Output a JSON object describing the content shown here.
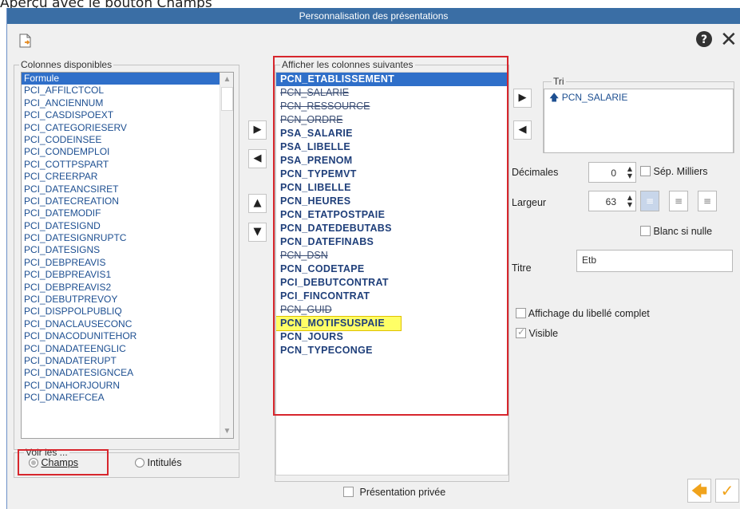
{
  "page_caption": "Aperçu avec le bouton Champs",
  "window": {
    "title": "Personnalisation des présentations"
  },
  "toolbar": {
    "doc_icon": "export-document-icon",
    "help_glyph": "?",
    "close_glyph": "✕"
  },
  "available": {
    "label": "Colonnes disponibles",
    "items": [
      "Formule",
      "PCI_AFFILCTCOL",
      "PCI_ANCIENNUM",
      "PCI_CASDISPOEXT",
      "PCI_CATEGORIESERV",
      "PCI_CODEINSEE",
      "PCI_CONDEMPLOI",
      "PCI_COTTPSPART",
      "PCI_CREERPAR",
      "PCI_DATEANCSIRET",
      "PCI_DATECREATION",
      "PCI_DATEMODIF",
      "PCI_DATESIGND",
      "PCI_DATESIGNRUPTC",
      "PCI_DATESIGNS",
      "PCI_DEBPREAVIS",
      "PCI_DEBPREAVIS1",
      "PCI_DEBPREAVIS2",
      "PCI_DEBUTPREVOY",
      "PCI_DISPPOLPUBLIQ",
      "PCI_DNACLAUSECONC",
      "PCI_DNACODUNITEHOR",
      "PCI_DNADATEENGLIC",
      "PCI_DNADATERUPT",
      "PCI_DNADATESIGNCEA",
      "PCI_DNAHORJOURN",
      "PCI_DNAREFCEA"
    ]
  },
  "view": {
    "label": "Voir les ...",
    "options": [
      {
        "label": "Champs",
        "selected": true
      },
      {
        "label": "Intitulés",
        "selected": false
      }
    ]
  },
  "move_buttons": {
    "add": "▶",
    "remove": "◀",
    "up": "▲",
    "down": "▼"
  },
  "shown": {
    "label": "Afficher les colonnes suivantes",
    "items": [
      {
        "name": "PCN_ETABLISSEMENT",
        "state": "selected"
      },
      {
        "name": "PCN_SALARIE",
        "state": "hidden"
      },
      {
        "name": "PCN_RESSOURCE",
        "state": "hidden"
      },
      {
        "name": "PCN_ORDRE",
        "state": "hidden"
      },
      {
        "name": "PSA_SALARIE",
        "state": "visible"
      },
      {
        "name": "PSA_LIBELLE",
        "state": "visible"
      },
      {
        "name": "PSA_PRENOM",
        "state": "visible"
      },
      {
        "name": "PCN_TYPEMVT",
        "state": "visible"
      },
      {
        "name": "PCN_LIBELLE",
        "state": "visible"
      },
      {
        "name": "PCN_HEURES",
        "state": "visible"
      },
      {
        "name": "PCN_ETATPOSTPAIE",
        "state": "visible"
      },
      {
        "name": "PCN_DATEDEBUTABS",
        "state": "visible"
      },
      {
        "name": "PCN_DATEFINABS",
        "state": "visible"
      },
      {
        "name": "PCN_DSN",
        "state": "hidden"
      },
      {
        "name": "PCN_CODETAPE",
        "state": "visible"
      },
      {
        "name": "PCI_DEBUTCONTRAT",
        "state": "visible"
      },
      {
        "name": "PCI_FINCONTRAT",
        "state": "visible"
      },
      {
        "name": "PCN_GUID",
        "state": "hidden"
      },
      {
        "name": "PCN_MOTIFSUSPAIE",
        "state": "highlighted"
      },
      {
        "name": "PCN_JOURS",
        "state": "visible"
      },
      {
        "name": "PCN_TYPECONGE",
        "state": "visible"
      }
    ]
  },
  "sort": {
    "label": "Tri",
    "items": [
      {
        "arrow": "🡅",
        "field": "PCN_SALARIE"
      }
    ],
    "add": "▶",
    "remove": "◀"
  },
  "props": {
    "decimales_label": "Décimales",
    "decimales_value": "0",
    "sep_milliers_label": "Sép. Milliers",
    "largeur_label": "Largeur",
    "largeur_value": "63",
    "blanc_label": "Blanc si nulle",
    "titre_label": "Titre",
    "titre_value": "Etb",
    "libelle_complet_label": "Affichage du libellé complet",
    "visible_label": "Visible"
  },
  "footer": {
    "private_label": "Présentation privée",
    "back_glyph": "🡄",
    "ok_glyph": "✓"
  },
  "colors": {
    "titlebar": "#3a6ea5",
    "selection": "#2f6fc9",
    "highlight": "#ffff66",
    "callout": "#d7262d",
    "back_arrow": "#f0a31c",
    "ok_check": "#f0a31c"
  }
}
